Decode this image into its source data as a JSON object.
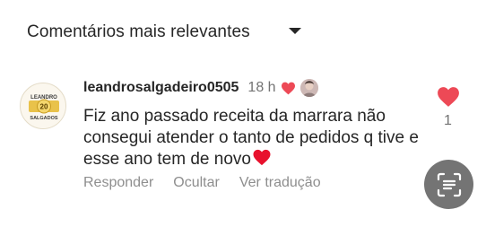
{
  "header": {
    "title": "Comentários mais relevantes",
    "sort_icon": "chevron-down-icon"
  },
  "comment": {
    "avatar_text_top": "LEANDRO",
    "avatar_text_bottom": "SALGADOS",
    "avatar_badge": "20",
    "username": "leandrosalgadeiro0505",
    "time": "18 h",
    "text": "Fiz ano passado receita da marrara não consegui atender o tanto de pedidos q tive e esse ano tem de novo",
    "trailing_emoji": "heart-emoji",
    "like_count": "1",
    "actions": {
      "reply": "Responder",
      "hide": "Ocultar",
      "translate": "Ver tradução"
    }
  },
  "colors": {
    "like_red": "#ed4956",
    "fab_gray": "#747474"
  }
}
